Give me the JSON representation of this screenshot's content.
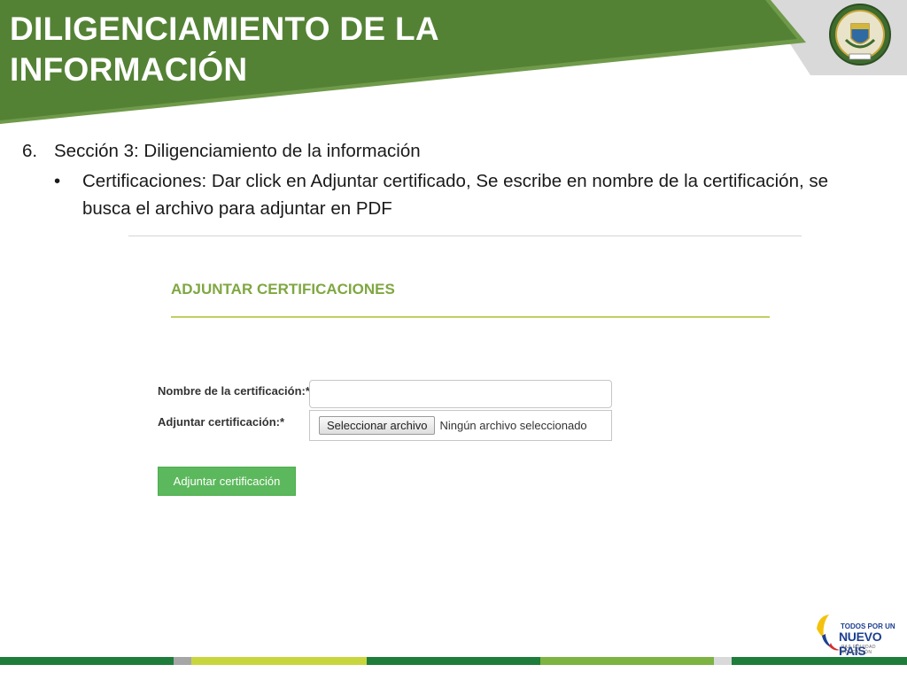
{
  "slide": {
    "title_line1": "DILIGENCIAMIENTO DE LA",
    "title_line2": "INFORMACIÓN",
    "header_green": "#548235",
    "header_gray": "#d9d9d9",
    "seal_icon": "policia-nacional-seal-icon"
  },
  "instructions": {
    "number": "6.",
    "heading": "Sección 3: Diligenciamiento de la información",
    "bullet": "•",
    "bullet_text": "Certificaciones: Dar click en Adjuntar certificado, Se escribe en nombre de la certificación, se busca el archivo para adjuntar en PDF"
  },
  "form": {
    "title": "ADJUNTAR CERTIFICACIONES",
    "name_label": "Nombre de la certificación:*",
    "name_value": "",
    "file_label": "Adjuntar certificación:*",
    "file_button": "Seleccionar archivo",
    "file_status": "Ningún archivo seleccionado",
    "submit_label": "Adjuntar certificación",
    "accent_color": "#7fa741",
    "button_color": "#5cb85c"
  },
  "footer": {
    "brand_line1": "TODOS POR UN",
    "brand_line2": "NUEVO PAÍS",
    "brand_line3": "PAZ EQUIDAD EDUCACIÓN",
    "brand_icon": "colombia-flag-swoosh-icon",
    "stripe_colors": [
      "#1e7d3a",
      "#a6a6a6",
      "#c8d63d",
      "#1e7d3a",
      "#7cb342",
      "#d9d9d9",
      "#1e7d3a"
    ]
  }
}
